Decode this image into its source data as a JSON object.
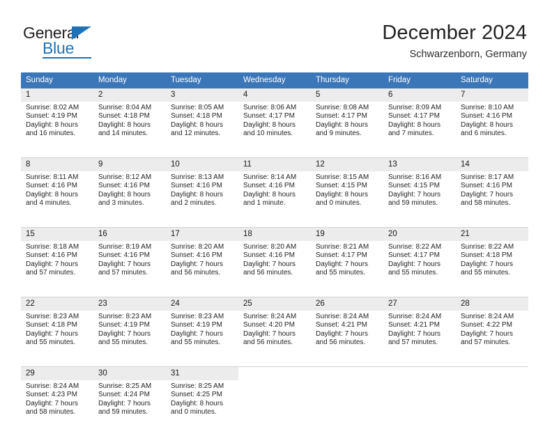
{
  "brand": {
    "name_top": "General",
    "name_bottom": "Blue"
  },
  "header": {
    "title": "December 2024",
    "subtitle": "Schwarzenborn, Germany"
  },
  "colors": {
    "header_blue": "#3a76b8",
    "brand_blue": "#1f72b5",
    "daynum_bg": "#ececec",
    "separator": "#d2d2d2"
  },
  "weekdays": [
    "Sunday",
    "Monday",
    "Tuesday",
    "Wednesday",
    "Thursday",
    "Friday",
    "Saturday"
  ],
  "weeks": [
    {
      "days": [
        {
          "num": "1",
          "sunrise": "Sunrise: 8:02 AM",
          "sunset": "Sunset: 4:19 PM",
          "daylight_1": "Daylight: 8 hours",
          "daylight_2": "and 16 minutes."
        },
        {
          "num": "2",
          "sunrise": "Sunrise: 8:04 AM",
          "sunset": "Sunset: 4:18 PM",
          "daylight_1": "Daylight: 8 hours",
          "daylight_2": "and 14 minutes."
        },
        {
          "num": "3",
          "sunrise": "Sunrise: 8:05 AM",
          "sunset": "Sunset: 4:18 PM",
          "daylight_1": "Daylight: 8 hours",
          "daylight_2": "and 12 minutes."
        },
        {
          "num": "4",
          "sunrise": "Sunrise: 8:06 AM",
          "sunset": "Sunset: 4:17 PM",
          "daylight_1": "Daylight: 8 hours",
          "daylight_2": "and 10 minutes."
        },
        {
          "num": "5",
          "sunrise": "Sunrise: 8:08 AM",
          "sunset": "Sunset: 4:17 PM",
          "daylight_1": "Daylight: 8 hours",
          "daylight_2": "and 9 minutes."
        },
        {
          "num": "6",
          "sunrise": "Sunrise: 8:09 AM",
          "sunset": "Sunset: 4:17 PM",
          "daylight_1": "Daylight: 8 hours",
          "daylight_2": "and 7 minutes."
        },
        {
          "num": "7",
          "sunrise": "Sunrise: 8:10 AM",
          "sunset": "Sunset: 4:16 PM",
          "daylight_1": "Daylight: 8 hours",
          "daylight_2": "and 6 minutes."
        }
      ]
    },
    {
      "days": [
        {
          "num": "8",
          "sunrise": "Sunrise: 8:11 AM",
          "sunset": "Sunset: 4:16 PM",
          "daylight_1": "Daylight: 8 hours",
          "daylight_2": "and 4 minutes."
        },
        {
          "num": "9",
          "sunrise": "Sunrise: 8:12 AM",
          "sunset": "Sunset: 4:16 PM",
          "daylight_1": "Daylight: 8 hours",
          "daylight_2": "and 3 minutes."
        },
        {
          "num": "10",
          "sunrise": "Sunrise: 8:13 AM",
          "sunset": "Sunset: 4:16 PM",
          "daylight_1": "Daylight: 8 hours",
          "daylight_2": "and 2 minutes."
        },
        {
          "num": "11",
          "sunrise": "Sunrise: 8:14 AM",
          "sunset": "Sunset: 4:16 PM",
          "daylight_1": "Daylight: 8 hours",
          "daylight_2": "and 1 minute."
        },
        {
          "num": "12",
          "sunrise": "Sunrise: 8:15 AM",
          "sunset": "Sunset: 4:15 PM",
          "daylight_1": "Daylight: 8 hours",
          "daylight_2": "and 0 minutes."
        },
        {
          "num": "13",
          "sunrise": "Sunrise: 8:16 AM",
          "sunset": "Sunset: 4:15 PM",
          "daylight_1": "Daylight: 7 hours",
          "daylight_2": "and 59 minutes."
        },
        {
          "num": "14",
          "sunrise": "Sunrise: 8:17 AM",
          "sunset": "Sunset: 4:16 PM",
          "daylight_1": "Daylight: 7 hours",
          "daylight_2": "and 58 minutes."
        }
      ]
    },
    {
      "days": [
        {
          "num": "15",
          "sunrise": "Sunrise: 8:18 AM",
          "sunset": "Sunset: 4:16 PM",
          "daylight_1": "Daylight: 7 hours",
          "daylight_2": "and 57 minutes."
        },
        {
          "num": "16",
          "sunrise": "Sunrise: 8:19 AM",
          "sunset": "Sunset: 4:16 PM",
          "daylight_1": "Daylight: 7 hours",
          "daylight_2": "and 57 minutes."
        },
        {
          "num": "17",
          "sunrise": "Sunrise: 8:20 AM",
          "sunset": "Sunset: 4:16 PM",
          "daylight_1": "Daylight: 7 hours",
          "daylight_2": "and 56 minutes."
        },
        {
          "num": "18",
          "sunrise": "Sunrise: 8:20 AM",
          "sunset": "Sunset: 4:16 PM",
          "daylight_1": "Daylight: 7 hours",
          "daylight_2": "and 56 minutes."
        },
        {
          "num": "19",
          "sunrise": "Sunrise: 8:21 AM",
          "sunset": "Sunset: 4:17 PM",
          "daylight_1": "Daylight: 7 hours",
          "daylight_2": "and 55 minutes."
        },
        {
          "num": "20",
          "sunrise": "Sunrise: 8:22 AM",
          "sunset": "Sunset: 4:17 PM",
          "daylight_1": "Daylight: 7 hours",
          "daylight_2": "and 55 minutes."
        },
        {
          "num": "21",
          "sunrise": "Sunrise: 8:22 AM",
          "sunset": "Sunset: 4:18 PM",
          "daylight_1": "Daylight: 7 hours",
          "daylight_2": "and 55 minutes."
        }
      ]
    },
    {
      "days": [
        {
          "num": "22",
          "sunrise": "Sunrise: 8:23 AM",
          "sunset": "Sunset: 4:18 PM",
          "daylight_1": "Daylight: 7 hours",
          "daylight_2": "and 55 minutes."
        },
        {
          "num": "23",
          "sunrise": "Sunrise: 8:23 AM",
          "sunset": "Sunset: 4:19 PM",
          "daylight_1": "Daylight: 7 hours",
          "daylight_2": "and 55 minutes."
        },
        {
          "num": "24",
          "sunrise": "Sunrise: 8:23 AM",
          "sunset": "Sunset: 4:19 PM",
          "daylight_1": "Daylight: 7 hours",
          "daylight_2": "and 55 minutes."
        },
        {
          "num": "25",
          "sunrise": "Sunrise: 8:24 AM",
          "sunset": "Sunset: 4:20 PM",
          "daylight_1": "Daylight: 7 hours",
          "daylight_2": "and 56 minutes."
        },
        {
          "num": "26",
          "sunrise": "Sunrise: 8:24 AM",
          "sunset": "Sunset: 4:21 PM",
          "daylight_1": "Daylight: 7 hours",
          "daylight_2": "and 56 minutes."
        },
        {
          "num": "27",
          "sunrise": "Sunrise: 8:24 AM",
          "sunset": "Sunset: 4:21 PM",
          "daylight_1": "Daylight: 7 hours",
          "daylight_2": "and 57 minutes."
        },
        {
          "num": "28",
          "sunrise": "Sunrise: 8:24 AM",
          "sunset": "Sunset: 4:22 PM",
          "daylight_1": "Daylight: 7 hours",
          "daylight_2": "and 57 minutes."
        }
      ]
    },
    {
      "days": [
        {
          "num": "29",
          "sunrise": "Sunrise: 8:24 AM",
          "sunset": "Sunset: 4:23 PM",
          "daylight_1": "Daylight: 7 hours",
          "daylight_2": "and 58 minutes."
        },
        {
          "num": "30",
          "sunrise": "Sunrise: 8:25 AM",
          "sunset": "Sunset: 4:24 PM",
          "daylight_1": "Daylight: 7 hours",
          "daylight_2": "and 59 minutes."
        },
        {
          "num": "31",
          "sunrise": "Sunrise: 8:25 AM",
          "sunset": "Sunset: 4:25 PM",
          "daylight_1": "Daylight: 8 hours",
          "daylight_2": "and 0 minutes."
        },
        {
          "num": "",
          "sunrise": "",
          "sunset": "",
          "daylight_1": "",
          "daylight_2": ""
        },
        {
          "num": "",
          "sunrise": "",
          "sunset": "",
          "daylight_1": "",
          "daylight_2": ""
        },
        {
          "num": "",
          "sunrise": "",
          "sunset": "",
          "daylight_1": "",
          "daylight_2": ""
        },
        {
          "num": "",
          "sunrise": "",
          "sunset": "",
          "daylight_1": "",
          "daylight_2": ""
        }
      ]
    }
  ]
}
